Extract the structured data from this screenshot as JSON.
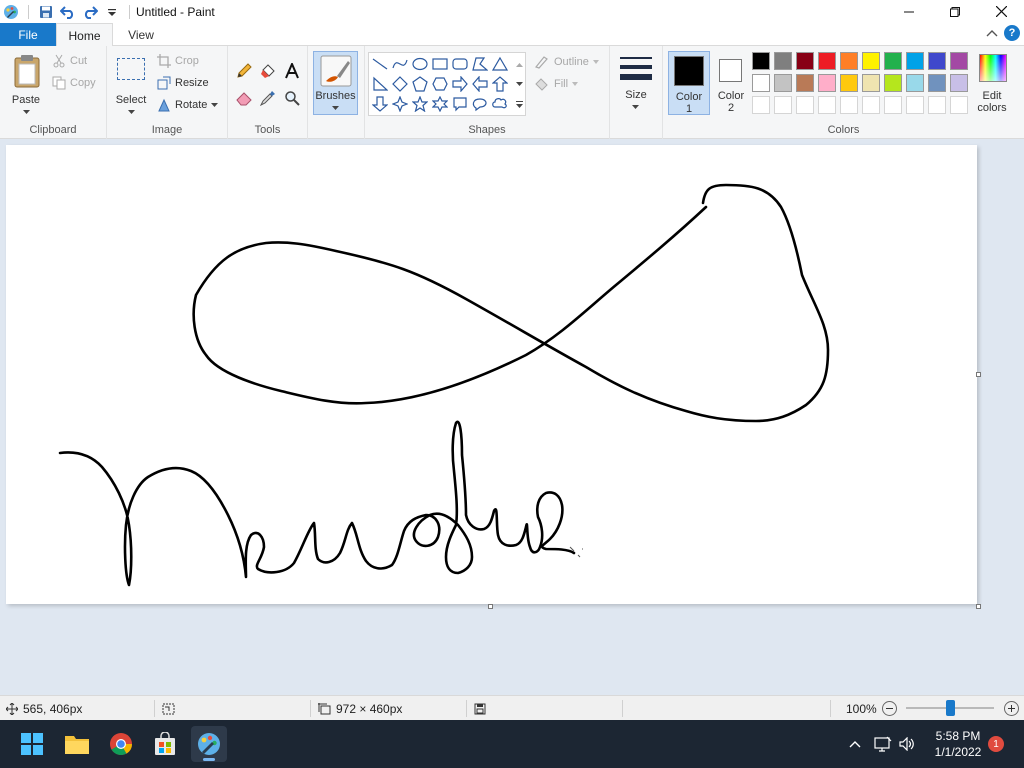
{
  "window": {
    "title": "Untitled - Paint"
  },
  "tabs": {
    "file": "File",
    "home": "Home",
    "view": "View"
  },
  "ribbon": {
    "clipboard": {
      "paste": "Paste",
      "cut": "Cut",
      "copy": "Copy",
      "group_label": "Clipboard"
    },
    "image": {
      "select": "Select",
      "crop": "Crop",
      "resize": "Resize",
      "rotate": "Rotate",
      "group_label": "Image"
    },
    "tools": {
      "group_label": "Tools"
    },
    "brushes": {
      "label": "Brushes"
    },
    "shapes": {
      "outline": "Outline",
      "fill": "Fill",
      "group_label": "Shapes"
    },
    "size": {
      "label": "Size"
    },
    "colors": {
      "color1_line1": "Color",
      "color1_line2": "1",
      "color2_line1": "Color",
      "color2_line2": "2",
      "edit_line1": "Edit",
      "edit_line2": "colors",
      "group_label": "Colors",
      "color1_value": "#000000",
      "color2_value": "#ffffff",
      "palette_row1": [
        "#000000",
        "#7f7f7f",
        "#880015",
        "#ed1c24",
        "#ff7f27",
        "#fff200",
        "#22b14c",
        "#00a2e8",
        "#3f48cc",
        "#a349a4"
      ],
      "palette_row2": [
        "#ffffff",
        "#c3c3c3",
        "#b97a57",
        "#ffaec9",
        "#ffc90e",
        "#efe4b0",
        "#b5e61d",
        "#99d9ea",
        "#7092be",
        "#c8bfe7"
      ]
    }
  },
  "statusbar": {
    "cursor_pos": "565, 406px",
    "selection_size": "",
    "canvas_size": "972 × 460px",
    "zoom": "100%",
    "zoom_level": 0.5
  },
  "taskbar": {
    "time": "5:58 PM",
    "date": "1/1/2022",
    "notification_count": "1"
  }
}
